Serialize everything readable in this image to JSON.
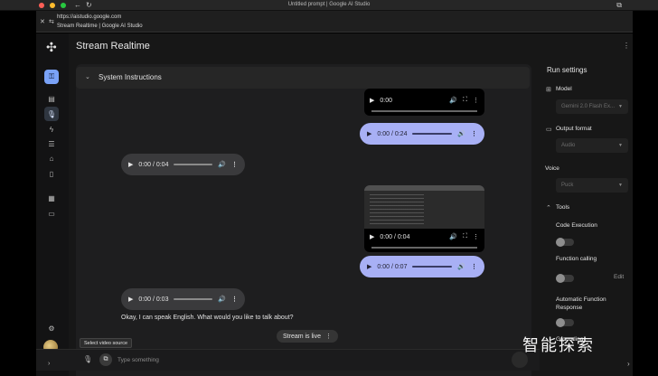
{
  "browser": {
    "window_title": "Untitled prompt | Google AI Studio",
    "url": "https://aistudio.google.com",
    "page_title": "Stream Realtime | Google AI Studio"
  },
  "app": {
    "title": "Stream Realtime"
  },
  "chat": {
    "system_instructions_label": "System Instructions",
    "messages": [
      {
        "role": "user",
        "kind": "video",
        "time": "0:00"
      },
      {
        "role": "user",
        "kind": "audio",
        "time": "0:00 / 0:24"
      },
      {
        "role": "model",
        "kind": "audio",
        "time": "0:00 / 0:04"
      },
      {
        "role": "user",
        "kind": "video",
        "time": "0:00 / 0:04"
      },
      {
        "role": "user",
        "kind": "audio",
        "time": "0:00 / 0:07"
      },
      {
        "role": "model",
        "kind": "audio",
        "time": "0:00 / 0:03"
      }
    ],
    "reply_text": "Okay, I can speak English. What would you like to talk about?",
    "stream_chip": "Stream is live"
  },
  "composer": {
    "tooltip": "Select video source",
    "placeholder": "Type something"
  },
  "run_settings": {
    "title": "Run settings",
    "model_label": "Model",
    "model_value": "Gemini 2.0 Flash Ex...",
    "output_label": "Output format",
    "output_value": "Audio",
    "voice_label": "Voice",
    "voice_value": "Puck",
    "tools_label": "Tools",
    "code_execution": "Code Execution",
    "function_calling": "Function calling",
    "edit_label": "Edit",
    "auto_function_response": "Automatic Function Response",
    "grounding": "Grounding"
  },
  "watermark": "智能探索"
}
